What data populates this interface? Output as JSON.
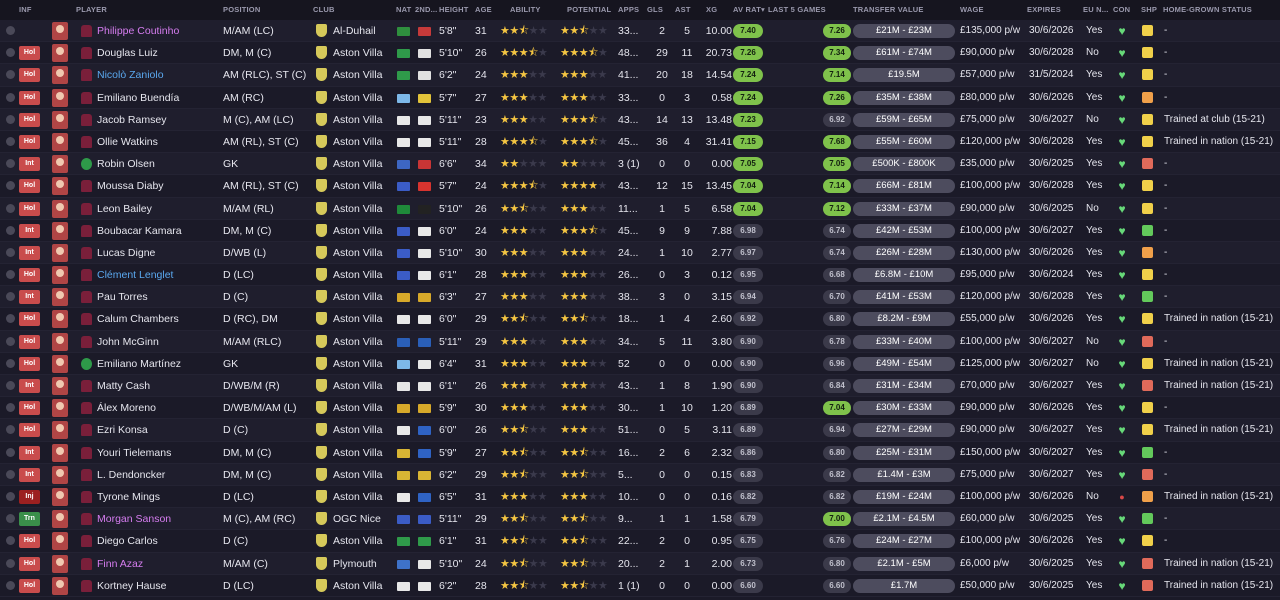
{
  "headers": {
    "inf": "INF",
    "player": "PLAYER",
    "position": "POSITION",
    "club": "CLUB",
    "nat": "NAT",
    "nat2": "2ND...",
    "height": "HEIGHT",
    "age": "AGE",
    "ability": "ABILITY",
    "potential": "POTENTIAL",
    "apps": "APPS",
    "gls": "GLS",
    "ast": "AST",
    "xg": "XG",
    "avrat": "AV RAT",
    "last5": "LAST 5 GAMES",
    "tv": "TRANSFER VALUE",
    "wage": "WAGE",
    "expires": "EXPIRES",
    "eu": "EU N...",
    "con": "CON",
    "shp": "SHP",
    "hgs": "HOME-GROWN STATUS"
  },
  "colors": {
    "row_odd": "#1f1e2d",
    "row_even": "#1b1a28",
    "rating_high": "#7fc24b",
    "loan_name": "#d67df0",
    "link_name": "#5aa8ef",
    "heart": "#67d979"
  },
  "rows": [
    {
      "inf": "",
      "name": "Philippe Coutinho",
      "style": "loan",
      "pos": "M/AM (LC)",
      "club": "Al-Duhail",
      "h": "5'8\"",
      "age": "31",
      "ab": 2.5,
      "pot": 2.5,
      "apps": "33...",
      "gls": "2",
      "ast": "5",
      "xg": "10.00",
      "av": "7.40",
      "last": "7.26",
      "tv": "£21M - £23M",
      "wage": "£135,000 p/w",
      "exp": "30/6/2026",
      "eu": "Yes",
      "con": "heart",
      "shp": "yellow",
      "hgs": "-",
      "keeper": false
    },
    {
      "inf": "Hol",
      "name": "Douglas Luiz",
      "style": "",
      "pos": "DM, M (C)",
      "club": "Aston Villa",
      "h": "5'10\"",
      "age": "26",
      "ab": 3.5,
      "pot": 3.5,
      "apps": "48...",
      "gls": "29",
      "ast": "11",
      "xg": "20.73",
      "av": "7.26",
      "last": "7.34",
      "tv": "£61M - £74M",
      "wage": "£90,000 p/w",
      "exp": "30/6/2028",
      "eu": "No",
      "con": "heart",
      "shp": "yellow",
      "hgs": "-",
      "keeper": false
    },
    {
      "inf": "Hol",
      "name": "Nicolò Zaniolo",
      "style": "link",
      "pos": "AM (RLC), ST (C)",
      "club": "Aston Villa",
      "h": "6'2\"",
      "age": "24",
      "ab": 3.0,
      "pot": 3.0,
      "apps": "41...",
      "gls": "20",
      "ast": "18",
      "xg": "14.54",
      "av": "7.24",
      "last": "7.14",
      "tv": "£19.5M",
      "wage": "£57,000 p/w",
      "exp": "31/5/2024",
      "eu": "Yes",
      "con": "heart",
      "shp": "yellow",
      "hgs": "-",
      "keeper": false
    },
    {
      "inf": "Hol",
      "name": "Emiliano Buendía",
      "style": "",
      "pos": "AM (RC)",
      "club": "Aston Villa",
      "h": "5'7\"",
      "age": "27",
      "ab": 3.0,
      "pot": 3.0,
      "apps": "33...",
      "gls": "0",
      "ast": "3",
      "xg": "0.58",
      "av": "7.24",
      "last": "7.26",
      "tv": "£35M - £38M",
      "wage": "£80,000 p/w",
      "exp": "30/6/2026",
      "eu": "Yes",
      "con": "heart",
      "shp": "orange",
      "hgs": "-",
      "keeper": false
    },
    {
      "inf": "Hol",
      "name": "Jacob Ramsey",
      "style": "",
      "pos": "M (C), AM (LC)",
      "club": "Aston Villa",
      "h": "5'11\"",
      "age": "23",
      "ab": 3.0,
      "pot": 3.5,
      "apps": "43...",
      "gls": "14",
      "ast": "13",
      "xg": "13.48",
      "av": "7.23",
      "last": "6.92",
      "tv": "£59M - £65M",
      "wage": "£75,000 p/w",
      "exp": "30/6/2027",
      "eu": "No",
      "con": "heart",
      "shp": "yellow",
      "hgs": "Trained at club (15-21)",
      "keeper": false
    },
    {
      "inf": "Hol",
      "name": "Ollie Watkins",
      "style": "",
      "pos": "AM (RL), ST (C)",
      "club": "Aston Villa",
      "h": "5'11\"",
      "age": "28",
      "ab": 3.5,
      "pot": 3.5,
      "apps": "45...",
      "gls": "36",
      "ast": "4",
      "xg": "31.41",
      "av": "7.15",
      "last": "7.68",
      "tv": "£55M - £60M",
      "wage": "£120,000 p/w",
      "exp": "30/6/2028",
      "eu": "Yes",
      "con": "heart",
      "shp": "yellow",
      "hgs": "Trained in nation (15-21)",
      "keeper": false
    },
    {
      "inf": "Int",
      "name": "Robin Olsen",
      "style": "",
      "pos": "GK",
      "club": "Aston Villa",
      "h": "6'6\"",
      "age": "34",
      "ab": 2.0,
      "pot": 2.0,
      "apps": "3 (1)",
      "gls": "0",
      "ast": "0",
      "xg": "0.00",
      "av": "7.05",
      "last": "7.05",
      "tv": "£500K - £800K",
      "wage": "£35,000 p/w",
      "exp": "30/6/2025",
      "eu": "Yes",
      "con": "heart",
      "shp": "red",
      "hgs": "-",
      "keeper": true
    },
    {
      "inf": "Hol",
      "name": "Moussa Diaby",
      "style": "",
      "pos": "AM (RL), ST (C)",
      "club": "Aston Villa",
      "h": "5'7\"",
      "age": "24",
      "ab": 3.5,
      "pot": 4.0,
      "apps": "43...",
      "gls": "12",
      "ast": "15",
      "xg": "13.45",
      "av": "7.04",
      "last": "7.14",
      "tv": "£66M - £81M",
      "wage": "£100,000 p/w",
      "exp": "30/6/2028",
      "eu": "Yes",
      "con": "heart",
      "shp": "yellow",
      "hgs": "-",
      "keeper": false
    },
    {
      "inf": "Hol",
      "name": "Leon Bailey",
      "style": "",
      "pos": "M/AM (RL)",
      "club": "Aston Villa",
      "h": "5'10\"",
      "age": "26",
      "ab": 2.5,
      "pot": 3.0,
      "apps": "11...",
      "gls": "1",
      "ast": "5",
      "xg": "6.58",
      "av": "7.04",
      "last": "7.12",
      "tv": "£33M - £37M",
      "wage": "£90,000 p/w",
      "exp": "30/6/2025",
      "eu": "No",
      "con": "heart",
      "shp": "yellow",
      "hgs": "-",
      "keeper": false
    },
    {
      "inf": "Int",
      "name": "Boubacar Kamara",
      "style": "",
      "pos": "DM, M (C)",
      "club": "Aston Villa",
      "h": "6'0\"",
      "age": "24",
      "ab": 3.0,
      "pot": 3.5,
      "apps": "45...",
      "gls": "9",
      "ast": "9",
      "xg": "7.88",
      "av": "6.98",
      "last": "6.74",
      "tv": "£42M - £53M",
      "wage": "£100,000 p/w",
      "exp": "30/6/2027",
      "eu": "Yes",
      "con": "heart",
      "shp": "green",
      "hgs": "-",
      "keeper": false
    },
    {
      "inf": "Int",
      "name": "Lucas Digne",
      "style": "",
      "pos": "D/WB (L)",
      "club": "Aston Villa",
      "h": "5'10\"",
      "age": "30",
      "ab": 3.0,
      "pot": 3.0,
      "apps": "24...",
      "gls": "1",
      "ast": "10",
      "xg": "2.77",
      "av": "6.97",
      "last": "6.74",
      "tv": "£26M - £28M",
      "wage": "£130,000 p/w",
      "exp": "30/6/2026",
      "eu": "Yes",
      "con": "heart",
      "shp": "orange",
      "hgs": "-",
      "keeper": false
    },
    {
      "inf": "Hol",
      "name": "Clément Lenglet",
      "style": "link",
      "pos": "D (LC)",
      "club": "Aston Villa",
      "h": "6'1\"",
      "age": "28",
      "ab": 3.0,
      "pot": 3.0,
      "apps": "26...",
      "gls": "0",
      "ast": "3",
      "xg": "0.12",
      "av": "6.95",
      "last": "6.68",
      "tv": "£6.8M - £10M",
      "wage": "£95,000 p/w",
      "exp": "30/6/2024",
      "eu": "Yes",
      "con": "heart",
      "shp": "yellow",
      "hgs": "-",
      "keeper": false
    },
    {
      "inf": "Int",
      "name": "Pau Torres",
      "style": "",
      "pos": "D (C)",
      "club": "Aston Villa",
      "h": "6'3\"",
      "age": "27",
      "ab": 3.0,
      "pot": 3.0,
      "apps": "38...",
      "gls": "3",
      "ast": "0",
      "xg": "3.15",
      "av": "6.94",
      "last": "6.70",
      "tv": "£41M - £53M",
      "wage": "£120,000 p/w",
      "exp": "30/6/2028",
      "eu": "Yes",
      "con": "heart",
      "shp": "green",
      "hgs": "-",
      "keeper": false
    },
    {
      "inf": "Hol",
      "name": "Calum Chambers",
      "style": "",
      "pos": "D (RC), DM",
      "club": "Aston Villa",
      "h": "6'0\"",
      "age": "29",
      "ab": 2.5,
      "pot": 2.5,
      "apps": "18...",
      "gls": "1",
      "ast": "4",
      "xg": "2.60",
      "av": "6.92",
      "last": "6.80",
      "tv": "£8.2M - £9M",
      "wage": "£55,000 p/w",
      "exp": "30/6/2026",
      "eu": "Yes",
      "con": "heart",
      "shp": "yellow",
      "hgs": "Trained in nation (15-21)",
      "keeper": false
    },
    {
      "inf": "Hol",
      "name": "John McGinn",
      "style": "",
      "pos": "M/AM (RLC)",
      "club": "Aston Villa",
      "h": "5'11\"",
      "age": "29",
      "ab": 3.0,
      "pot": 3.0,
      "apps": "34...",
      "gls": "5",
      "ast": "11",
      "xg": "3.80",
      "av": "6.90",
      "last": "6.78",
      "tv": "£33M - £40M",
      "wage": "£100,000 p/w",
      "exp": "30/6/2027",
      "eu": "No",
      "con": "heart",
      "shp": "red",
      "hgs": "-",
      "keeper": false
    },
    {
      "inf": "Hol",
      "name": "Emiliano Martínez",
      "style": "",
      "pos": "GK",
      "club": "Aston Villa",
      "h": "6'4\"",
      "age": "31",
      "ab": 3.0,
      "pot": 3.0,
      "apps": "52",
      "gls": "0",
      "ast": "0",
      "xg": "0.00",
      "av": "6.90",
      "last": "6.96",
      "tv": "£49M - £54M",
      "wage": "£125,000 p/w",
      "exp": "30/6/2027",
      "eu": "No",
      "con": "heart",
      "shp": "yellow",
      "hgs": "Trained in nation (15-21)",
      "keeper": true
    },
    {
      "inf": "Int",
      "name": "Matty Cash",
      "style": "",
      "pos": "D/WB/M (R)",
      "club": "Aston Villa",
      "h": "6'1\"",
      "age": "26",
      "ab": 3.0,
      "pot": 3.0,
      "apps": "43...",
      "gls": "1",
      "ast": "8",
      "xg": "1.90",
      "av": "6.90",
      "last": "6.84",
      "tv": "£31M - £34M",
      "wage": "£70,000 p/w",
      "exp": "30/6/2027",
      "eu": "Yes",
      "con": "heart",
      "shp": "red",
      "hgs": "Trained in nation (15-21)",
      "keeper": false
    },
    {
      "inf": "Hol",
      "name": "Álex Moreno",
      "style": "",
      "pos": "D/WB/M/AM (L)",
      "club": "Aston Villa",
      "h": "5'9\"",
      "age": "30",
      "ab": 3.0,
      "pot": 3.0,
      "apps": "30...",
      "gls": "1",
      "ast": "10",
      "xg": "1.20",
      "av": "6.89",
      "last": "7.04",
      "tv": "£30M - £33M",
      "wage": "£90,000 p/w",
      "exp": "30/6/2026",
      "eu": "Yes",
      "con": "heart",
      "shp": "yellow",
      "hgs": "-",
      "keeper": false
    },
    {
      "inf": "Hol",
      "name": "Ezri Konsa",
      "style": "",
      "pos": "D (C)",
      "club": "Aston Villa",
      "h": "6'0\"",
      "age": "26",
      "ab": 2.5,
      "pot": 3.0,
      "apps": "51...",
      "gls": "0",
      "ast": "5",
      "xg": "3.11",
      "av": "6.89",
      "last": "6.94",
      "tv": "£27M - £29M",
      "wage": "£90,000 p/w",
      "exp": "30/6/2027",
      "eu": "Yes",
      "con": "heart",
      "shp": "yellow",
      "hgs": "Trained in nation (15-21)",
      "keeper": false
    },
    {
      "inf": "Int",
      "name": "Youri Tielemans",
      "style": "",
      "pos": "DM, M (C)",
      "club": "Aston Villa",
      "h": "5'9\"",
      "age": "27",
      "ab": 2.5,
      "pot": 2.5,
      "apps": "16...",
      "gls": "2",
      "ast": "6",
      "xg": "2.32",
      "av": "6.86",
      "last": "6.80",
      "tv": "£25M - £31M",
      "wage": "£150,000 p/w",
      "exp": "30/6/2027",
      "eu": "Yes",
      "con": "heart",
      "shp": "green",
      "hgs": "-",
      "keeper": false
    },
    {
      "inf": "Int",
      "name": "L. Dendoncker",
      "style": "",
      "pos": "DM, M (C)",
      "club": "Aston Villa",
      "h": "6'2\"",
      "age": "29",
      "ab": 2.5,
      "pot": 2.5,
      "apps": "5...",
      "gls": "0",
      "ast": "0",
      "xg": "0.15",
      "av": "6.83",
      "last": "6.82",
      "tv": "£1.4M - £3M",
      "wage": "£75,000 p/w",
      "exp": "30/6/2027",
      "eu": "Yes",
      "con": "heart",
      "shp": "red",
      "hgs": "-",
      "keeper": false
    },
    {
      "inf": "Inj",
      "name": "Tyrone Mings",
      "style": "",
      "pos": "D (LC)",
      "club": "Aston Villa",
      "h": "6'5\"",
      "age": "31",
      "ab": 3.0,
      "pot": 3.0,
      "apps": "10...",
      "gls": "0",
      "ast": "0",
      "xg": "0.16",
      "av": "6.82",
      "last": "6.82",
      "tv": "£19M - £24M",
      "wage": "£100,000 p/w",
      "exp": "30/6/2026",
      "eu": "No",
      "con": "dot",
      "shp": "orange",
      "hgs": "Trained in nation (15-21)",
      "keeper": false
    },
    {
      "inf": "Trn",
      "name": "Morgan Sanson",
      "style": "loan",
      "pos": "M (C), AM (RC)",
      "club": "OGC Nice",
      "h": "5'11\"",
      "age": "29",
      "ab": 2.5,
      "pot": 2.5,
      "apps": "9...",
      "gls": "1",
      "ast": "1",
      "xg": "1.58",
      "av": "6.79",
      "last": "7.00",
      "tv": "£2.1M - £4.5M",
      "wage": "£60,000 p/w",
      "exp": "30/6/2025",
      "eu": "Yes",
      "con": "heart",
      "shp": "green",
      "hgs": "-",
      "keeper": false
    },
    {
      "inf": "Hol",
      "name": "Diego Carlos",
      "style": "",
      "pos": "D (C)",
      "club": "Aston Villa",
      "h": "6'1\"",
      "age": "31",
      "ab": 2.5,
      "pot": 2.5,
      "apps": "22...",
      "gls": "2",
      "ast": "0",
      "xg": "0.95",
      "av": "6.75",
      "last": "6.76",
      "tv": "£24M - £27M",
      "wage": "£100,000 p/w",
      "exp": "30/6/2026",
      "eu": "Yes",
      "con": "heart",
      "shp": "yellow",
      "hgs": "-",
      "keeper": false
    },
    {
      "inf": "Hol",
      "name": "Finn Azaz",
      "style": "loan",
      "pos": "M/AM (C)",
      "club": "Plymouth",
      "h": "5'10\"",
      "age": "24",
      "ab": 2.5,
      "pot": 2.5,
      "apps": "20...",
      "gls": "2",
      "ast": "1",
      "xg": "2.00",
      "av": "6.73",
      "last": "6.80",
      "tv": "£2.1M - £5M",
      "wage": "£6,000 p/w",
      "exp": "30/6/2025",
      "eu": "Yes",
      "con": "heart",
      "shp": "red",
      "hgs": "Trained in nation (15-21)",
      "keeper": false
    },
    {
      "inf": "Hol",
      "name": "Kortney Hause",
      "style": "",
      "pos": "D (LC)",
      "club": "Aston Villa",
      "h": "6'2\"",
      "age": "28",
      "ab": 2.5,
      "pot": 2.5,
      "apps": "1 (1)",
      "gls": "0",
      "ast": "0",
      "xg": "0.00",
      "av": "6.60",
      "last": "6.60",
      "tv": "£1.7M",
      "wage": "£50,000 p/w",
      "exp": "30/6/2025",
      "eu": "Yes",
      "con": "heart",
      "shp": "red",
      "hgs": "Trained in nation (15-21)",
      "keeper": false
    }
  ]
}
